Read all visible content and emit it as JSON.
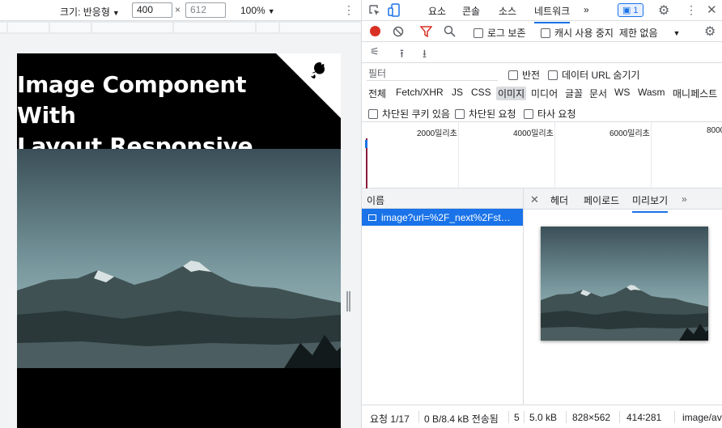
{
  "device_toolbar": {
    "size_label": "크기: 반응형",
    "width_value": "400",
    "height_placeholder": "612",
    "times": "×",
    "zoom": "100%"
  },
  "page": {
    "title_line1": "Image Component With",
    "title_line2": "Layout Responsive"
  },
  "devtools": {
    "tabs": [
      "요소",
      "콘솔",
      "소스",
      "네트워크"
    ],
    "active_tab": "네트워크",
    "more_tabs": "»",
    "issues_count": "1",
    "toolbar": {
      "preserve_log": "로그 보존",
      "disable_cache": "캐시 사용 중지",
      "throttle": "제한 없음"
    },
    "filter": {
      "placeholder": "필터",
      "invert": "반전",
      "hide_data_urls": "데이터 URL 숨기기"
    },
    "type_filters": [
      "전체",
      "Fetch/XHR",
      "JS",
      "CSS",
      "이미지",
      "미디어",
      "글꼴",
      "문서",
      "WS",
      "Wasm",
      "매니페스트"
    ],
    "selected_type": "이미지",
    "blocked_options": [
      "차단된 쿠키 있음",
      "차단된 요청",
      "타사 요청"
    ],
    "timeline_labels": [
      "2000밀리초",
      "4000밀리초",
      "6000밀리초",
      "8000"
    ],
    "name_header": "이름",
    "request_name": "image?url=%2F_next%2Fst…",
    "detail_tabs": [
      "헤더",
      "페이로드",
      "미리보기"
    ],
    "active_detail_tab": "미리보기",
    "status": {
      "requests": "요청 1/17",
      "transferred": "0 B/8.4 kB 전송됨",
      "extra": "5",
      "size": "5.0 kB",
      "dimensions": "828×562",
      "ratio": "414∶281",
      "mime": "image/av"
    }
  }
}
